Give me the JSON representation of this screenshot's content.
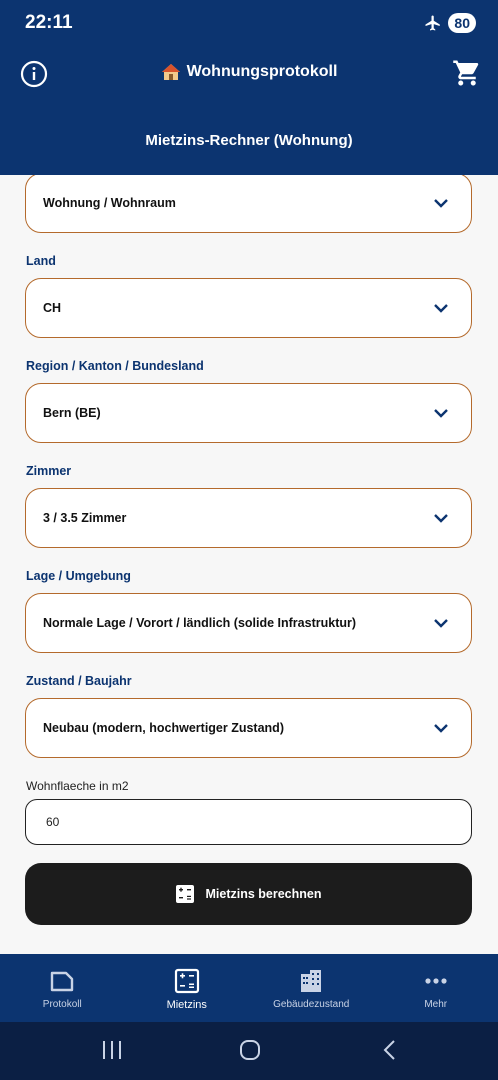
{
  "status": {
    "time": "22:11",
    "battery": "80"
  },
  "header": {
    "title": "Wohnungsprotokoll",
    "subtitle": "Mietzins-Rechner (Wohnung)"
  },
  "form": {
    "type_value": "Wohnung / Wohnraum",
    "land_label": "Land",
    "land_value": "CH",
    "region_label": "Region / Kanton / Bundesland",
    "region_value": "Bern (BE)",
    "rooms_label": "Zimmer",
    "rooms_value": "3 / 3.5 Zimmer",
    "location_label": "Lage / Umgebung",
    "location_value": "Normale Lage / Vorort / ländlich (solide Infrastruktur)",
    "condition_label": "Zustand / Baujahr",
    "condition_value": "Neubau (modern, hochwertiger Zustand)",
    "area_label": "Wohnflaeche in m2",
    "area_value": "60",
    "calc_button": "Mietzins berechnen"
  },
  "nav": {
    "protokoll": "Protokoll",
    "mietzins": "Mietzins",
    "gebaeude": "Gebäudezustand",
    "mehr": "Mehr"
  },
  "colors": {
    "primary": "#0c3470",
    "accent_border": "#b46a2c",
    "button": "#1c1c1c"
  }
}
